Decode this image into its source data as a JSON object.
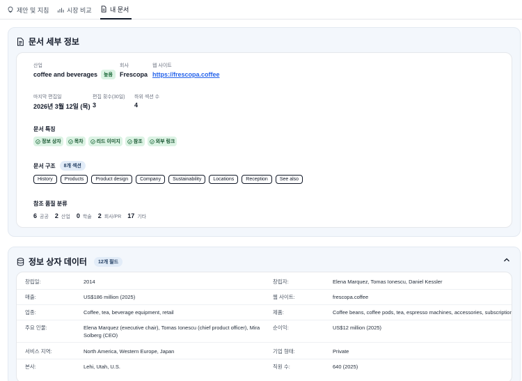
{
  "tabs": [
    {
      "label": "제안 및 지침",
      "icon": "lightbulb-icon"
    },
    {
      "label": "시장 비교",
      "icon": "bar-chart-icon"
    },
    {
      "label": "내 문서",
      "icon": "document-icon"
    }
  ],
  "details": {
    "title": "문서 세부 정보",
    "industry_label": "산업",
    "industry_value": "coffee and beverages",
    "industry_badge": "높음",
    "company_label": "회사",
    "company_value": "Frescopa",
    "website_label": "웹 사이트",
    "website_value": "https://frescopa.coffee",
    "last_edit_label": "마지막 편집일",
    "last_edit_value": "2026년 3월 12일 (목)",
    "edit_count_label": "편집 횟수(30일)",
    "edit_count_value": "3",
    "subsections_label": "하위 섹션 수",
    "subsections_value": "4",
    "features_title": "문서 특징",
    "features": [
      "정보 상자",
      "목차",
      "리드 이미지",
      "참조",
      "외부 링크"
    ],
    "structure_title": "문서 구조",
    "structure_badge": "8개 섹션",
    "sections": [
      "History",
      "Products",
      "Product design",
      "Company",
      "Sustainability",
      "Locations",
      "Reception",
      "See also"
    ],
    "refs_title": "참조 품질 분류",
    "refs": [
      {
        "n": "6",
        "t": "공공"
      },
      {
        "n": "2",
        "t": "산업"
      },
      {
        "n": "0",
        "t": "학술"
      },
      {
        "n": "2",
        "t": "회사/PR"
      },
      {
        "n": "17",
        "t": "기타"
      }
    ]
  },
  "infobox": {
    "title": "정보 상자 데이터",
    "badge": "12개 필드",
    "rows": [
      {
        "k1": "창립일:",
        "v1": "2014",
        "k2": "창립자:",
        "v2": "Elena Marquez, Tomas Ionescu, Daniel Kessler"
      },
      {
        "k1": "매출:",
        "v1": "US$186 million (2025)",
        "k2": "웹 사이트:",
        "v2": "frescopa.coffee"
      },
      {
        "k1": "업종:",
        "v1": "Coffee, tea, beverage equipment, retail",
        "k2": "제품:",
        "v2": "Coffee beans, coffee pods, tea, espresso machines, accessories, subscriptions"
      },
      {
        "k1": "주요 인물:",
        "v1": "Elena Marquez (executive chair), Tomas Ionescu (chief product officer), Mira Solberg (CEO)",
        "k2": "순이익:",
        "v2": "US$12 million (2025)"
      },
      {
        "k1": "서비스 지역:",
        "v1": "North America, Western Europe, Japan",
        "k2": "기업 형태:",
        "v2": "Private"
      },
      {
        "k1": "본사:",
        "v1": "Lehi, Utah, U.S.",
        "k2": "직원 수:",
        "v2": "640 (2025)"
      }
    ]
  }
}
